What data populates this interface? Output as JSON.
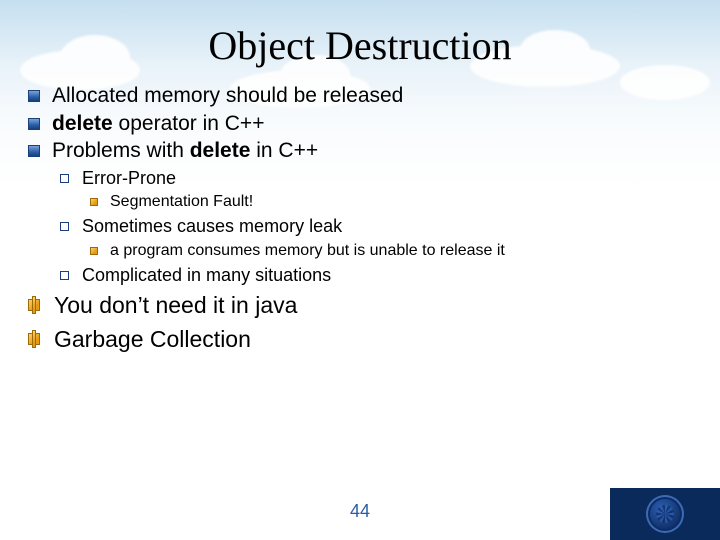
{
  "title": "Object Destruction",
  "bullets": {
    "b1_pre": "Allocated memory should be released",
    "b2_bold": "delete",
    "b2_rest": " operator in C++",
    "b3_pre": "Problems with ",
    "b3_bold": "delete",
    "b3_rest": " in C++",
    "s1": "Error-Prone",
    "s1a": "Segmentation Fault!",
    "s2": "Sometimes causes memory leak",
    "s2a": "a program consumes memory but is unable to release it",
    "s3": "Complicated in many situations",
    "c1": "You don’t need it in java",
    "c2": "Garbage Collection"
  },
  "page_number": "44"
}
